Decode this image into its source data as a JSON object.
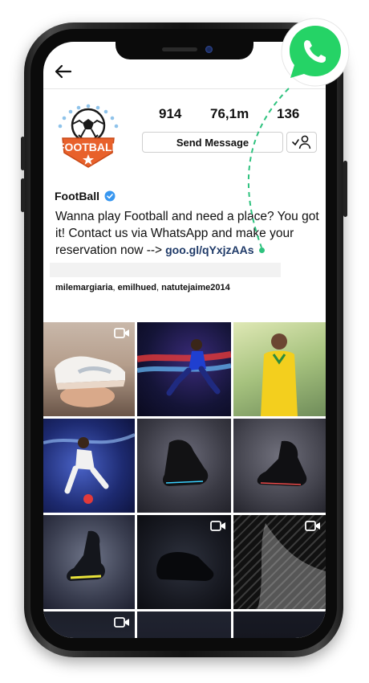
{
  "profile": {
    "name": "FootBall",
    "verified": true,
    "logo_text": "FOOTBALL",
    "stats": {
      "posts": "914",
      "followers": "76,1m",
      "following": "136"
    },
    "send_message_label": "Send Message",
    "bio": "Wanna play Football and need a place? You got it! Contact us via WhatsApp and make your reservation now -->",
    "bio_link": "goo.gl/qYxjzAAs",
    "followed_by": {
      "u1": "milemargiaria",
      "u2": "emilhued",
      "u3": "natutejaime2014",
      "sep": ", "
    }
  },
  "grid": {
    "posts": [
      {
        "video": true
      },
      {
        "video": false
      },
      {
        "video": false
      },
      {
        "video": false
      },
      {
        "video": false
      },
      {
        "video": false
      },
      {
        "video": false
      },
      {
        "video": true
      },
      {
        "video": true
      },
      {
        "video": true
      },
      {
        "video": false
      },
      {
        "video": false
      }
    ]
  },
  "icons": {
    "back": "arrow-left-icon",
    "verified": "verified-badge-icon",
    "follow": "person-check-icon",
    "video": "video-camera-icon",
    "whatsapp": "whatsapp-icon"
  },
  "colors": {
    "whatsapp_green": "#2ec27e",
    "verified_blue": "#3897f0",
    "link_blue": "#1f3a68",
    "logo_orange": "#e8612b"
  }
}
